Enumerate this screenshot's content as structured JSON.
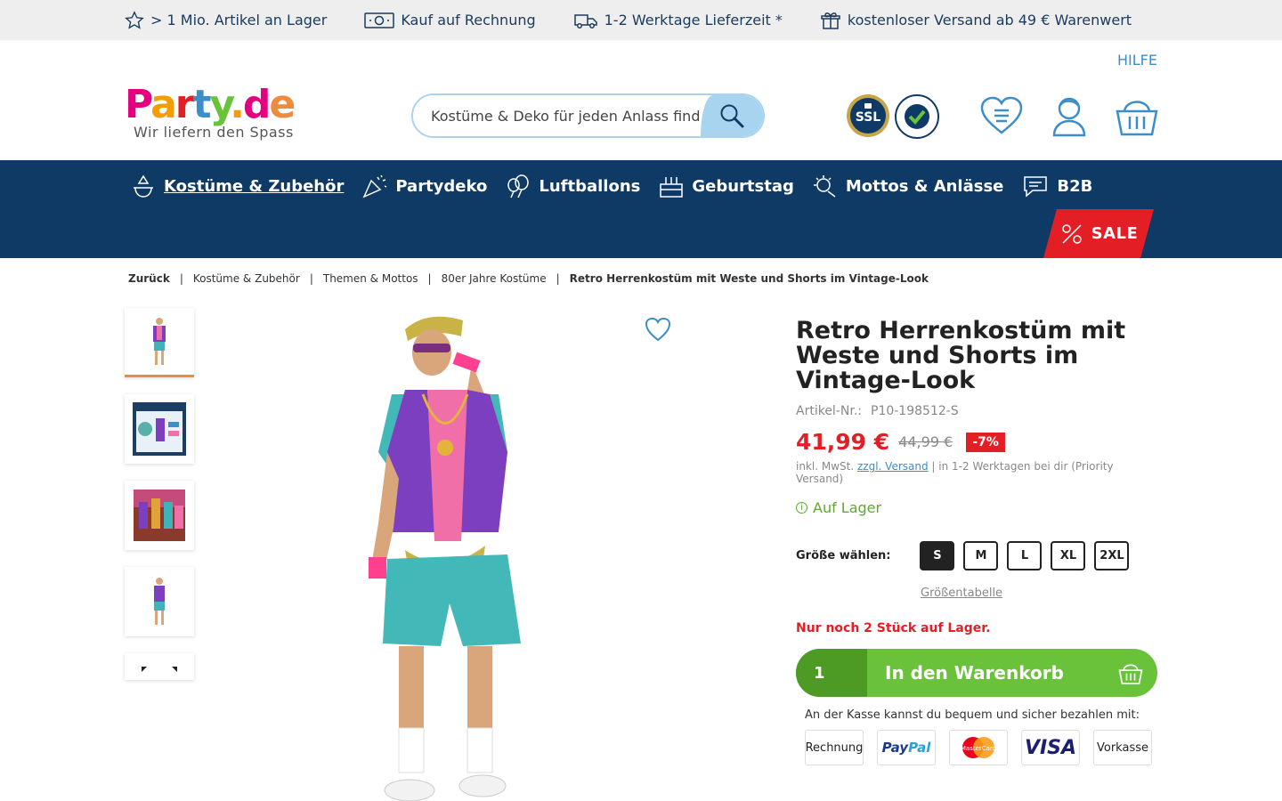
{
  "topbar": {
    "items": [
      {
        "icon": "star-icon",
        "text": "> 1 Mio. Artikel an Lager"
      },
      {
        "icon": "money-icon",
        "text": "Kauf auf Rechnung"
      },
      {
        "icon": "truck-icon",
        "text": "1-2 Werktage Lieferzeit *"
      },
      {
        "icon": "gift-icon",
        "text": "kostenloser Versand ab 49 € Warenwert"
      }
    ]
  },
  "header": {
    "help_label": " HILFE",
    "logo_text": "Party.de",
    "tagline": "Wir liefern den Spass",
    "search_placeholder": "Kostüme & Deko für jeden Anlass finden"
  },
  "nav": {
    "items": [
      {
        "label": "Kostüme & Zubehör",
        "icon": "costume-icon"
      },
      {
        "label": "Partydeko",
        "icon": "confetti-icon"
      },
      {
        "label": "Luftballons",
        "icon": "balloon-icon"
      },
      {
        "label": "Geburtstag",
        "icon": "cake-icon"
      },
      {
        "label": "Mottos & Anlässe",
        "icon": "theme-icon"
      },
      {
        "label": "B2B",
        "icon": "chat-icon"
      }
    ],
    "sale_label": "SALE"
  },
  "breadcrumb": {
    "back": "Zurück",
    "items": [
      "Kostüme & Zubehör",
      "Themen & Mottos",
      "80er Jahre Kostüme"
    ],
    "current": "Retro Herrenkostüm mit Weste und Shorts im Vintage-Look"
  },
  "product": {
    "title": "Retro Herrenkostüm mit Weste und Shorts im Vintage-Look",
    "artnr_label": "Artikel-Nr.:",
    "artnr": "P10-198512-S",
    "price": "41,99 €",
    "old_price": "44,99 €",
    "discount": "-7%",
    "tax_prefix": "inkl. MwSt.",
    "shipping_link": "zzgl. Versand",
    "tax_suffix": "| in 1-2 Werktagen bei dir (Priority Versand)",
    "stock": "Auf Lager",
    "size_label": "Größe wählen:",
    "sizes": [
      "S",
      "M",
      "L",
      "XL",
      "2XL"
    ],
    "size_table": "Größentabelle",
    "low_stock": " Nur noch 2 Stück auf Lager.",
    "qty": "1",
    "cart_label": "In den Warenkorb",
    "payment_info": "An der Kasse kannst du bequem und sicher bezahlen mit:",
    "payment_methods": [
      "Rechnung",
      "PayPal",
      "MasterCard",
      "VISA",
      "Vorkasse"
    ]
  },
  "colors": {
    "nav_bg": "#0f3a66",
    "sale": "#e31e24",
    "price": "#e31e24",
    "cart": "#6ac13a",
    "stock": "#5cab2e"
  }
}
